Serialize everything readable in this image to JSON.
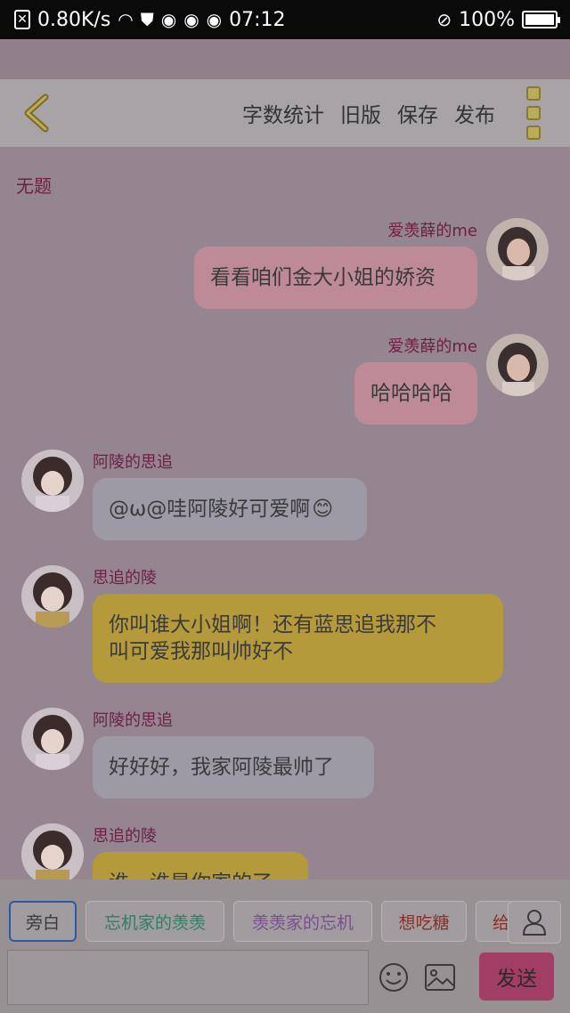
{
  "status_bar": {
    "speed": "0.80K/s",
    "time": "07:12",
    "battery": "100%",
    "battery_level": 1.0
  },
  "toolbar": {
    "actions": [
      "字数统计",
      "旧版",
      "保存",
      "发布"
    ]
  },
  "chat": {
    "title": "无题",
    "messages": [
      {
        "sender": "爱羡薛的me",
        "text": "看看咱们金大小姐的娇资",
        "side": "right"
      },
      {
        "sender": "爱羡薛的me",
        "text": "哈哈哈哈",
        "side": "right"
      },
      {
        "sender": "阿陵的思追",
        "text": "@ω@哇阿陵好可爱啊",
        "emoji": "😊",
        "side": "left"
      },
      {
        "sender": "思追的陵",
        "line1": "你叫谁大小姐啊！还有蓝思追我那不",
        "line2": "叫可爱我那叫帅好不",
        "side": "left"
      },
      {
        "sender": "阿陵的思追",
        "text": "好好好，我家阿陵最帅了",
        "side": "left"
      },
      {
        "sender": "思追的陵",
        "text": "谁，谁是你家的了",
        "side": "left"
      }
    ]
  },
  "input": {
    "roles": [
      "旁白",
      "忘机家的羡羡",
      "羡羡家的忘机",
      "想吃糖",
      "给"
    ],
    "role_colors": [
      "#3a3a3a",
      "#2f7f62",
      "#7a4e8c",
      "#8c2f26",
      "#8c2f26"
    ],
    "message_value": "",
    "send_label": "发送"
  }
}
